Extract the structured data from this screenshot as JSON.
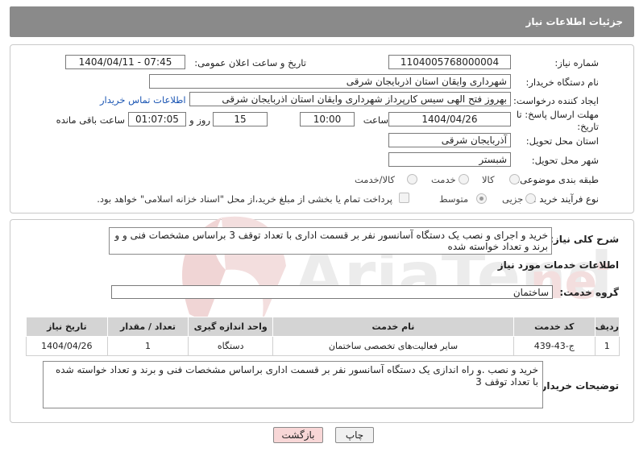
{
  "header": {
    "title": "جزئیات اطلاعات نیاز"
  },
  "form": {
    "need_number_label": "شماره نیاز:",
    "need_number": "1104005768000004",
    "announce_label": "تاریخ و ساعت اعلان عمومی:",
    "announce_value": "1404/04/11 - 07:45",
    "buyer_org_label": "نام دستگاه خریدار:",
    "buyer_org": "شهرداری وایقان استان اذربایجان شرقی",
    "creator_label": "ایجاد کننده درخواست:",
    "creator": "بهروز فتح الهی سیس کارپرداز شهرداری وایقان استان اذربایجان شرقی",
    "contact_link": "اطلاعات تماس خریدار",
    "deadline_label": "مهلت ارسال پاسخ: تا تاریخ:",
    "deadline_date": "1404/04/26",
    "hour_label": "ساعت",
    "deadline_time": "10:00",
    "days_value": "15",
    "days_label": "روز و",
    "remaining_time": "01:07:05",
    "remaining_label": "ساعت باقی مانده",
    "province_label": "استان محل تحویل:",
    "province": "آذربایجان شرقی",
    "city_label": "شهر محل تحویل:",
    "city": "شبستر",
    "category_label": "طبقه بندی موضوعی:",
    "category_options": [
      "کالا",
      "خدمت",
      "کالا/خدمت"
    ],
    "category_selected": "خدمت",
    "process_label": "نوع فرآیند خرید :",
    "process_options": [
      "جزیی",
      "متوسط"
    ],
    "process_selected": "متوسط",
    "payment_note": "پرداخت تمام یا بخشی از مبلغ خرید،از محل \"اسناد خزانه اسلامی\" خواهد بود."
  },
  "summary": {
    "label": "شرح کلی نیاز:",
    "text": "خرید و اجرای و نصب یک دستگاه آسانسور نفر بر قسمت اداری با تعداد توقف 3 براساس مشخصات فنی و و برند و تعداد خواسته شده"
  },
  "services": {
    "section_title": "اطلاعات خدمات مورد نیاز",
    "group_label": "گروه خدمت:",
    "group_value": "ساختمان",
    "columns": [
      "ردیف",
      "کد خدمت",
      "نام خدمت",
      "واحد اندازه گیری",
      "تعداد / مقدار",
      "تاریخ نیاز"
    ],
    "rows": [
      {
        "row": "1",
        "code": "ج-43-439",
        "name": "سایر فعالیت‌های تخصصی ساختمان",
        "unit": "دستگاه",
        "qty": "1",
        "date": "1404/04/26"
      }
    ]
  },
  "buyer_notes": {
    "label": "توضیحات خریدار:",
    "text": "خرید و نصب .و راه اندازی یک دستگاه آسانسور نفر بر قسمت اداری براساس مشخصات فنی و برند و تعداد خواسته شده با تعداد توقف 3"
  },
  "buttons": {
    "print": "چاپ",
    "back": "بازگشت"
  },
  "watermark": {
    "text": "AriaTender.neT"
  },
  "colors": {
    "header": "#8a8a8a",
    "link": "#1a55b3",
    "back_button": "#f8d7d7"
  }
}
